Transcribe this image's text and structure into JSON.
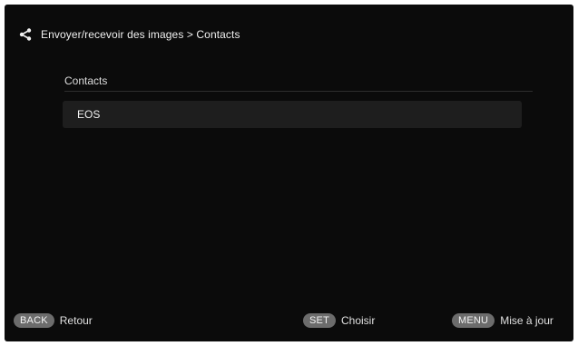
{
  "header": {
    "icon": "share-icon",
    "breadcrumb": "Envoyer/recevoir des images > Contacts"
  },
  "section": {
    "title": "Contacts"
  },
  "contacts": [
    {
      "label": "EOS"
    }
  ],
  "footer": {
    "back": {
      "key": "BACK",
      "label": "Retour"
    },
    "set": {
      "key": "SET",
      "label": "Choisir"
    },
    "menu": {
      "key": "MENU",
      "label": "Mise à jour"
    }
  },
  "colors": {
    "background": "#0b0b0b",
    "list_item": "#1e1e1e",
    "key_badge": "#6c6c6c",
    "text": "#e6e6e6"
  }
}
